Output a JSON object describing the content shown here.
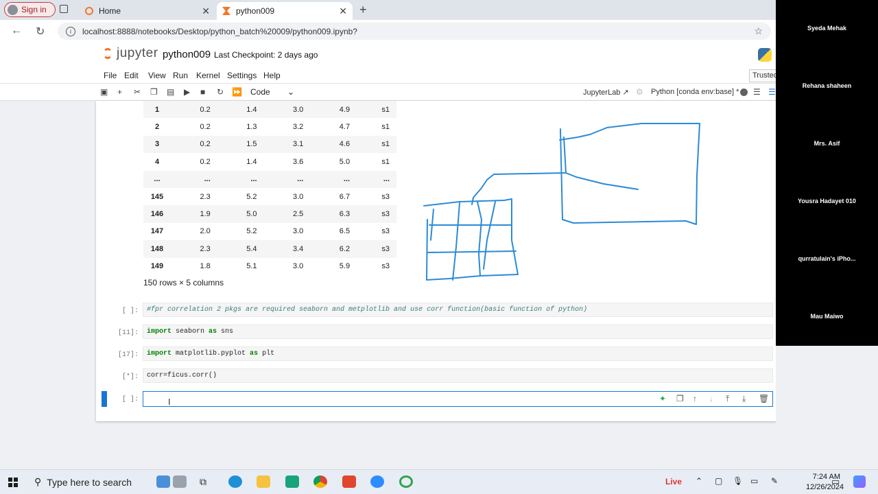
{
  "browser": {
    "signin_label": "Sign in",
    "tabs": [
      {
        "label": "Home",
        "active": false
      },
      {
        "label": "python009",
        "active": true
      }
    ],
    "newtab_glyph": "+",
    "url": "localhost:8888/notebooks/Desktop/python_batch%20009/python009.ipynb?"
  },
  "jupyter": {
    "logo_text": "jupyter",
    "notebook_name": "python009",
    "checkpoint": "Last Checkpoint: 2 days ago",
    "menu": [
      "File",
      "Edit",
      "View",
      "Run",
      "Kernel",
      "Settings",
      "Help"
    ],
    "trusted": "Trusted",
    "cell_type": "Code",
    "lab_link": "JupyterLab",
    "kernel": "Python [conda env:base] *"
  },
  "dataframe": {
    "rows": [
      [
        "1",
        "0.2",
        "1.4",
        "3.0",
        "4.9",
        "s1"
      ],
      [
        "2",
        "0.2",
        "1.3",
        "3.2",
        "4.7",
        "s1"
      ],
      [
        "3",
        "0.2",
        "1.5",
        "3.1",
        "4.6",
        "s1"
      ],
      [
        "4",
        "0.2",
        "1.4",
        "3.6",
        "5.0",
        "s1"
      ],
      [
        "...",
        "...",
        "...",
        "...",
        "...",
        "..."
      ],
      [
        "145",
        "2.3",
        "5.2",
        "3.0",
        "6.7",
        "s3"
      ],
      [
        "146",
        "1.9",
        "5.0",
        "2.5",
        "6.3",
        "s3"
      ],
      [
        "147",
        "2.0",
        "5.2",
        "3.0",
        "6.5",
        "s3"
      ],
      [
        "148",
        "2.3",
        "5.4",
        "3.4",
        "6.2",
        "s3"
      ],
      [
        "149",
        "1.8",
        "5.1",
        "3.0",
        "5.9",
        "s3"
      ]
    ],
    "row_count": "150 rows × 5 columns"
  },
  "cells": [
    {
      "prompt": "[ ]:",
      "code_comment": "#fpr correlation 2 pkgs are required seaborn and metplotlib and use corr function(basic function of python)"
    },
    {
      "prompt": "[11]:",
      "kw1": "import",
      "mod": " seaborn ",
      "kw2": "as",
      "alias": " sns"
    },
    {
      "prompt": "[17]:",
      "kw1": "import",
      "mod": " matplotlib.pyplot ",
      "kw2": "as",
      "alias": " plt"
    },
    {
      "prompt": "[*]:",
      "code": "corr=ficus.corr()"
    },
    {
      "prompt": "[ ]:",
      "code": ""
    }
  ],
  "participants": [
    "Syeda Mehak",
    "Rehana shaheen",
    "Mrs. Asif",
    "Yousra Hadayet 010",
    "qurratulain's  iPho...",
    "Mau Maiwo"
  ],
  "taskbar": {
    "search_placeholder": "Type here to search",
    "live": "Live",
    "time": "7:24 AM",
    "date": "12/26/2024"
  }
}
